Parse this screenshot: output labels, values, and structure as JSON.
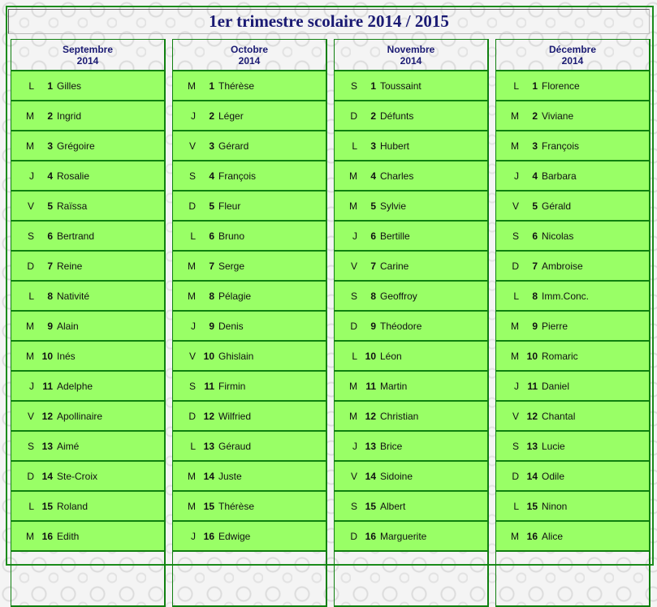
{
  "title": "1er trimestre scolaire 2014 / 2015",
  "months": [
    {
      "name": "Septembre",
      "year": "2014",
      "days": [
        {
          "dow": "L",
          "day": "1",
          "saint": "Gilles"
        },
        {
          "dow": "M",
          "day": "2",
          "saint": "Ingrid"
        },
        {
          "dow": "M",
          "day": "3",
          "saint": "Grégoire"
        },
        {
          "dow": "J",
          "day": "4",
          "saint": "Rosalie"
        },
        {
          "dow": "V",
          "day": "5",
          "saint": "Raïssa"
        },
        {
          "dow": "S",
          "day": "6",
          "saint": "Bertrand"
        },
        {
          "dow": "D",
          "day": "7",
          "saint": "Reine"
        },
        {
          "dow": "L",
          "day": "8",
          "saint": "Nativité"
        },
        {
          "dow": "M",
          "day": "9",
          "saint": "Alain"
        },
        {
          "dow": "M",
          "day": "10",
          "saint": "Inés"
        },
        {
          "dow": "J",
          "day": "11",
          "saint": "Adelphe"
        },
        {
          "dow": "V",
          "day": "12",
          "saint": "Apollinaire"
        },
        {
          "dow": "S",
          "day": "13",
          "saint": "Aimé"
        },
        {
          "dow": "D",
          "day": "14",
          "saint": "Ste-Croix"
        },
        {
          "dow": "L",
          "day": "15",
          "saint": "Roland"
        },
        {
          "dow": "M",
          "day": "16",
          "saint": "Edith"
        }
      ]
    },
    {
      "name": "Octobre",
      "year": "2014",
      "days": [
        {
          "dow": "M",
          "day": "1",
          "saint": "Thérèse"
        },
        {
          "dow": "J",
          "day": "2",
          "saint": "Léger"
        },
        {
          "dow": "V",
          "day": "3",
          "saint": "Gérard"
        },
        {
          "dow": "S",
          "day": "4",
          "saint": "François"
        },
        {
          "dow": "D",
          "day": "5",
          "saint": "Fleur"
        },
        {
          "dow": "L",
          "day": "6",
          "saint": "Bruno"
        },
        {
          "dow": "M",
          "day": "7",
          "saint": "Serge"
        },
        {
          "dow": "M",
          "day": "8",
          "saint": "Pélagie"
        },
        {
          "dow": "J",
          "day": "9",
          "saint": "Denis"
        },
        {
          "dow": "V",
          "day": "10",
          "saint": "Ghislain"
        },
        {
          "dow": "S",
          "day": "11",
          "saint": "Firmin"
        },
        {
          "dow": "D",
          "day": "12",
          "saint": "Wilfried"
        },
        {
          "dow": "L",
          "day": "13",
          "saint": "Géraud"
        },
        {
          "dow": "M",
          "day": "14",
          "saint": "Juste"
        },
        {
          "dow": "M",
          "day": "15",
          "saint": "Thérèse"
        },
        {
          "dow": "J",
          "day": "16",
          "saint": "Edwige"
        }
      ]
    },
    {
      "name": "Novembre",
      "year": "2014",
      "days": [
        {
          "dow": "S",
          "day": "1",
          "saint": "Toussaint"
        },
        {
          "dow": "D",
          "day": "2",
          "saint": "Défunts"
        },
        {
          "dow": "L",
          "day": "3",
          "saint": "Hubert"
        },
        {
          "dow": "M",
          "day": "4",
          "saint": "Charles"
        },
        {
          "dow": "M",
          "day": "5",
          "saint": "Sylvie"
        },
        {
          "dow": "J",
          "day": "6",
          "saint": "Bertille"
        },
        {
          "dow": "V",
          "day": "7",
          "saint": "Carine"
        },
        {
          "dow": "S",
          "day": "8",
          "saint": "Geoffroy"
        },
        {
          "dow": "D",
          "day": "9",
          "saint": "Théodore"
        },
        {
          "dow": "L",
          "day": "10",
          "saint": "Léon"
        },
        {
          "dow": "M",
          "day": "11",
          "saint": "Martin"
        },
        {
          "dow": "M",
          "day": "12",
          "saint": "Christian"
        },
        {
          "dow": "J",
          "day": "13",
          "saint": "Brice"
        },
        {
          "dow": "V",
          "day": "14",
          "saint": "Sidoine"
        },
        {
          "dow": "S",
          "day": "15",
          "saint": "Albert"
        },
        {
          "dow": "D",
          "day": "16",
          "saint": "Marguerite"
        }
      ]
    },
    {
      "name": "Décembre",
      "year": "2014",
      "days": [
        {
          "dow": "L",
          "day": "1",
          "saint": "Florence"
        },
        {
          "dow": "M",
          "day": "2",
          "saint": "Viviane"
        },
        {
          "dow": "M",
          "day": "3",
          "saint": "François"
        },
        {
          "dow": "J",
          "day": "4",
          "saint": "Barbara"
        },
        {
          "dow": "V",
          "day": "5",
          "saint": "Gérald"
        },
        {
          "dow": "S",
          "day": "6",
          "saint": "Nicolas"
        },
        {
          "dow": "D",
          "day": "7",
          "saint": "Ambroise"
        },
        {
          "dow": "L",
          "day": "8",
          "saint": "Imm.Conc."
        },
        {
          "dow": "M",
          "day": "9",
          "saint": "Pierre"
        },
        {
          "dow": "M",
          "day": "10",
          "saint": "Romaric"
        },
        {
          "dow": "J",
          "day": "11",
          "saint": "Daniel"
        },
        {
          "dow": "V",
          "day": "12",
          "saint": "Chantal"
        },
        {
          "dow": "S",
          "day": "13",
          "saint": "Lucie"
        },
        {
          "dow": "D",
          "day": "14",
          "saint": "Odile"
        },
        {
          "dow": "L",
          "day": "15",
          "saint": "Ninon"
        },
        {
          "dow": "M",
          "day": "16",
          "saint": "Alice"
        }
      ]
    }
  ]
}
